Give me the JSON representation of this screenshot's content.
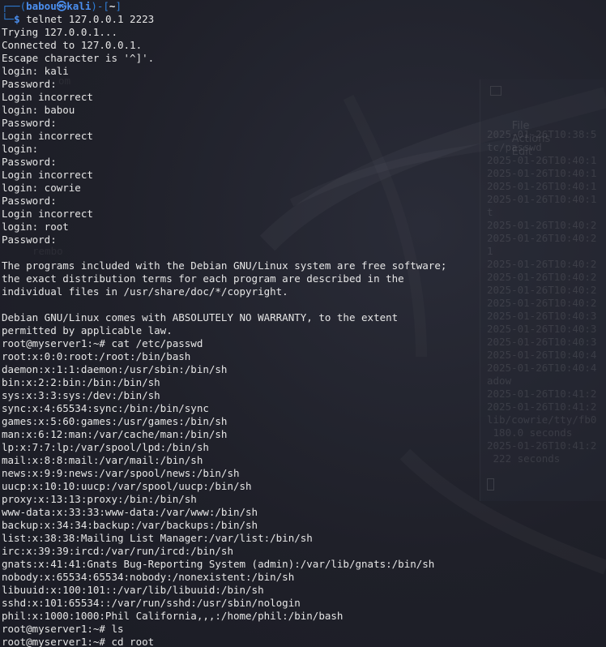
{
  "prompt": {
    "frame_top": "┌──(",
    "user_host": "babou㉿kali",
    "dir_open": ")-[",
    "dir": "~",
    "dir_close": "]",
    "frame_bottom": "└─",
    "dollar": "$",
    "command": " telnet 127.0.0.1 2223"
  },
  "output": [
    "Trying 127.0.0.1...",
    "Connected to 127.0.0.1.",
    "Escape character is '^]'.",
    "login: kali",
    "Password:",
    "Login incorrect",
    "login: babou",
    "Password:",
    "Login incorrect",
    "login:",
    "Password:",
    "Login incorrect",
    "login: cowrie",
    "Password:",
    "Login incorrect",
    "login: root",
    "Password:",
    "",
    "The programs included with the Debian GNU/Linux system are free software;",
    "the exact distribution terms for each program are described in the",
    "individual files in /usr/share/doc/*/copyright.",
    "",
    "Debian GNU/Linux comes with ABSOLUTELY NO WARRANTY, to the extent",
    "permitted by applicable law.",
    "root@myserver1:~# cat /etc/passwd",
    "root:x:0:0:root:/root:/bin/bash",
    "daemon:x:1:1:daemon:/usr/sbin:/bin/sh",
    "bin:x:2:2:bin:/bin:/bin/sh",
    "sys:x:3:3:sys:/dev:/bin/sh",
    "sync:x:4:65534:sync:/bin:/bin/sync",
    "games:x:5:60:games:/usr/games:/bin/sh",
    "man:x:6:12:man:/var/cache/man:/bin/sh",
    "lp:x:7:7:lp:/var/spool/lpd:/bin/sh",
    "mail:x:8:8:mail:/var/mail:/bin/sh",
    "news:x:9:9:news:/var/spool/news:/bin/sh",
    "uucp:x:10:10:uucp:/var/spool/uucp:/bin/sh",
    "proxy:x:13:13:proxy:/bin:/bin/sh",
    "www-data:x:33:33:www-data:/var/www:/bin/sh",
    "backup:x:34:34:backup:/var/backups:/bin/sh",
    "list:x:38:38:Mailing List Manager:/var/list:/bin/sh",
    "irc:x:39:39:ircd:/var/run/ircd:/bin/sh",
    "gnats:x:41:41:Gnats Bug-Reporting System (admin):/var/lib/gnats:/bin/sh",
    "nobody:x:65534:65534:nobody:/nonexistent:/bin/sh",
    "libuuid:x:100:101::/var/lib/libuuid:/bin/sh",
    "sshd:x:101:65534::/var/run/sshd:/usr/sbin/nologin",
    "phil:x:1000:1000:Phil California,,,:/home/phil:/bin/bash",
    "root@myserver1:~# ls",
    "root@myserver1:~# cd root"
  ],
  "background_window": {
    "menu": [
      "File",
      "Actions",
      "Edit"
    ],
    "lines": [
      "2025-01-26T10:38:5",
      "tc/passwd",
      "2025-01-26T10:40:1",
      "2025-01-26T10:40:1",
      "2025-01-26T10:40:1",
      "2025-01-26T10:40:1",
      "t",
      "2025-01-26T10:40:2",
      "2025-01-26T10:40:2",
      "1",
      "2025-01-26T10:40:2",
      "2025-01-26T10:40:2",
      "2025-01-26T10:40:2",
      "2025-01-26T10:40:2",
      "2025-01-26T10:40:3",
      "2025-01-26T10:40:3",
      "2025-01-26T10:40:3",
      "2025-01-26T10:40:4",
      "2025-01-26T10:40:4",
      "adow",
      "2025-01-26T10:41:2",
      "2025-01-26T10:41:2",
      "lib/cowrie/tty/fb0",
      " 180.0 seconds",
      "2025-01-26T10:41:2",
      " 222 seconds"
    ]
  },
  "colors": {
    "background": "#1e1f29",
    "text": "#e6e6e6",
    "prompt_frame": "#2f7dd6",
    "prompt_user": "#4b8ff0"
  }
}
